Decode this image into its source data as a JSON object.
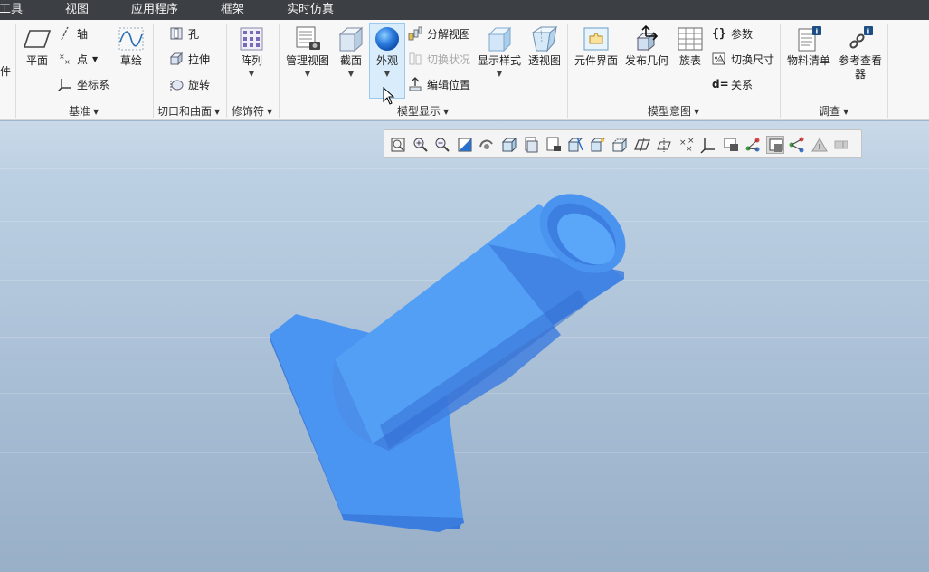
{
  "menubar": {
    "items": [
      "工具",
      "视图",
      "应用程序",
      "框架",
      "实时仿真"
    ]
  },
  "ribbon": {
    "partial_left_label": "件",
    "datum": {
      "group_label": "基准",
      "plane": "平面",
      "axis": "轴",
      "point": "点",
      "csys": "坐标系",
      "sketch": "草绘"
    },
    "cuts": {
      "group_label": "切口和曲面",
      "hole": "孔",
      "extrude": "拉伸",
      "revolve": "旋转"
    },
    "modifiers": {
      "group_label": "修饰符",
      "pattern": "阵列"
    },
    "model_display": {
      "group_label": "模型显示",
      "manage_views": "管理视图",
      "section": "截面",
      "appearance": "外观",
      "exploded_view": "分解视图",
      "toggle_status": "切换状况",
      "edit_position": "编辑位置",
      "display_style": "显示样式",
      "perspective": "透视图"
    },
    "model_intent": {
      "group_label": "模型意图",
      "component_interface": "元件界面",
      "publish_geometry": "发布几何",
      "family_table": "族表",
      "parameters": "参数",
      "switch_dimensions": "切换尺寸",
      "relations": "关系"
    },
    "investigate": {
      "group_label": "调查",
      "bill_of_materials": "物料清单",
      "reference_viewer": "参考查看器"
    }
  },
  "graphics_toolbar": {
    "icons": [
      "refit-icon",
      "zoom-in-icon",
      "zoom-out-icon",
      "repaint-icon",
      "spin-center-icon",
      "display-style-icon",
      "saved-orientations-icon",
      "view-manager-icon",
      "section-icon",
      "perspective-icon",
      "appearance-icon",
      "datum-plane-display-icon",
      "datum-axis-display-icon",
      "datum-point-display-icon",
      "csys-display-icon",
      "annotation-display-icon",
      "spin-toggle-icon",
      "active-display-icon",
      "network-icon",
      "triangle-icon",
      "dimension-icon"
    ]
  },
  "colors": {
    "menubar": "#3c4044",
    "ribbon": "#f7f7f7",
    "model_blue": "#4a95f2",
    "viewport_top": "#c9d9e8",
    "viewport_bottom": "#98afc8"
  }
}
